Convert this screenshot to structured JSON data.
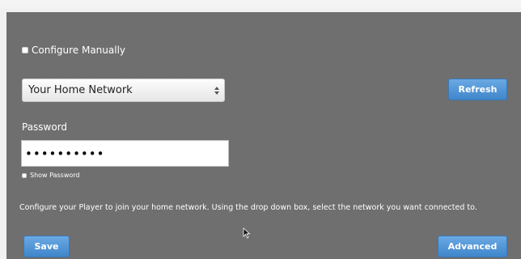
{
  "configure_manually": {
    "label": "Configure Manually",
    "checked": false
  },
  "network_select": {
    "value": "Your Home Network"
  },
  "refresh_button": {
    "label": "Refresh"
  },
  "password": {
    "label": "Password",
    "value": "••••••••••"
  },
  "show_password": {
    "label": "Show Password",
    "checked": false
  },
  "instructions": "Configure your Player to join your home network. Using the drop down box, select the network you want connected to.",
  "save_button": {
    "label": "Save"
  },
  "advanced_button": {
    "label": "Advanced"
  },
  "colors": {
    "panel_background": "#6f6f6f",
    "button_blue": "#4a90d4",
    "text": "#ffffff"
  }
}
